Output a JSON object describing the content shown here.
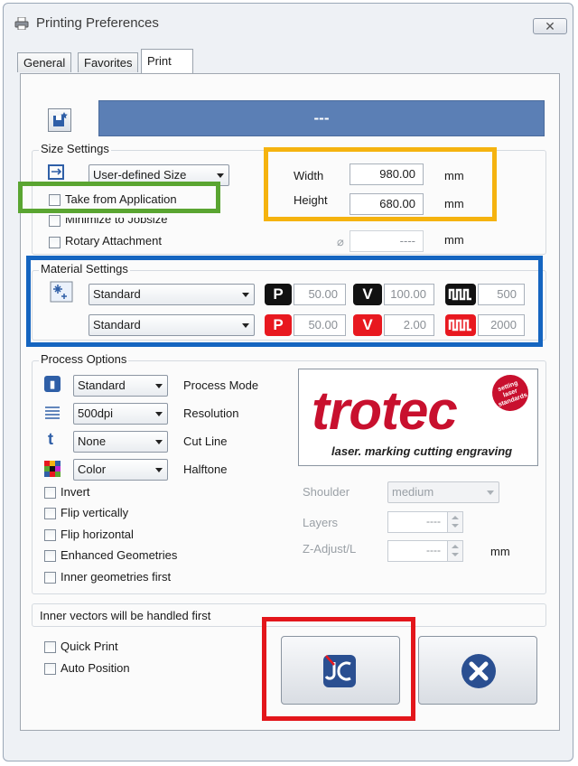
{
  "window": {
    "title": "Printing Preferences"
  },
  "tabs": [
    {
      "label": "General",
      "active": false
    },
    {
      "label": "Favorites",
      "active": false
    },
    {
      "label": "Print",
      "active": true
    }
  ],
  "job_banner": {
    "text": "---",
    "color": "#5b7fb5"
  },
  "size_settings": {
    "label": "Size Settings",
    "size_select": "User-defined Size",
    "take_from_application": {
      "label": "Take from Application",
      "checked": false
    },
    "minimize_to_jobsize": {
      "label": "Minimize to Jobsize",
      "checked": false
    },
    "rotary_attachment": {
      "label": "Rotary Attachment",
      "checked": false
    },
    "width": {
      "label": "Width",
      "value": "980.00",
      "unit": "mm"
    },
    "height": {
      "label": "Height",
      "value": "680.00",
      "unit": "mm"
    },
    "diameter": {
      "symbol": "⌀",
      "value": "----",
      "unit": "mm"
    }
  },
  "material_settings": {
    "label": "Material Settings",
    "engrave": {
      "material": "Standard",
      "power": "50.00",
      "velocity": "100.00",
      "ppi": "500",
      "badge_color": "#111111"
    },
    "cut": {
      "material": "Standard",
      "power": "50.00",
      "velocity": "2.00",
      "ppi": "2000",
      "badge_color": "#e8181f"
    },
    "power_letter": "P",
    "velocity_letter": "V"
  },
  "process_options": {
    "label": "Process Options",
    "process_mode": {
      "value": "Standard",
      "label": "Process Mode"
    },
    "resolution": {
      "value": "500dpi",
      "label": "Resolution"
    },
    "cut_line": {
      "value": "None",
      "label": "Cut Line"
    },
    "halftone": {
      "value": "Color",
      "label": "Halftone"
    },
    "invert": {
      "label": "Invert",
      "checked": false
    },
    "flip_vertically": {
      "label": "Flip vertically",
      "checked": false
    },
    "flip_horizontal": {
      "label": "Flip horizontal",
      "checked": false
    },
    "enhanced_geometries": {
      "label": "Enhanced Geometries",
      "checked": false
    },
    "inner_geometries_first": {
      "label": "Inner geometries first",
      "checked": false
    },
    "shoulder": {
      "label": "Shoulder",
      "value": "medium"
    },
    "layers": {
      "label": "Layers",
      "value": "----"
    },
    "z_adjust": {
      "label": "Z-Adjust/L",
      "value": "----",
      "unit": "mm"
    }
  },
  "logo": {
    "name": "trotec",
    "tagline": "laser. marking cutting engraving",
    "badge": "setting laser standards",
    "brand_color": "#c8102e"
  },
  "status": {
    "text": "Inner vectors will be handled first"
  },
  "bottom": {
    "quick_print": {
      "label": "Quick Print",
      "checked": false
    },
    "auto_position": {
      "label": "Auto Position",
      "checked": false
    }
  },
  "highlights": {
    "green": "#5aa531",
    "orange": "#f5b30f",
    "blue": "#1565c0",
    "red": "#e3161b"
  }
}
